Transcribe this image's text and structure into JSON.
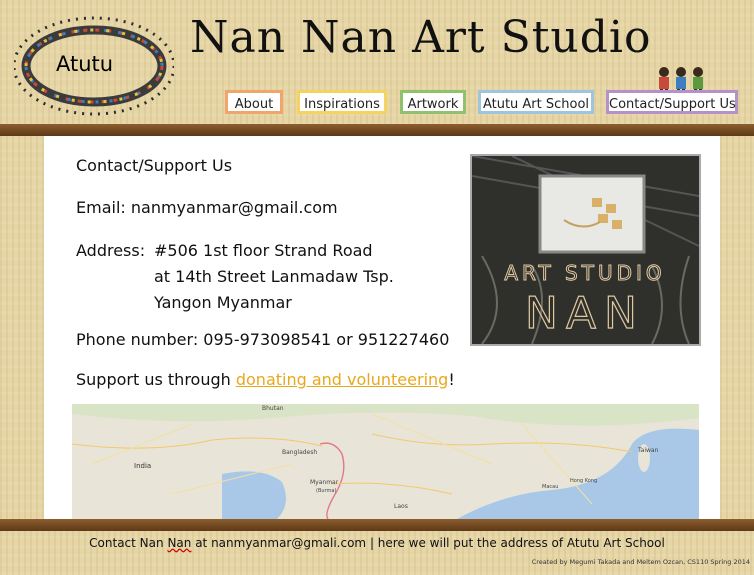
{
  "header": {
    "logo_label": "Atutu",
    "title": "Nan Nan Art Studio"
  },
  "nav": [
    {
      "label": "About",
      "color": "#f2a56b"
    },
    {
      "label": "Inspirations",
      "color": "#f4d35e"
    },
    {
      "label": "Artwork",
      "color": "#8fc26a"
    },
    {
      "label": "Atutu Art School",
      "color": "#9ec4de"
    },
    {
      "label": "Contact/Support Us",
      "color": "#b690c8"
    }
  ],
  "contact": {
    "heading": "Contact/Support Us",
    "email": "Email: nanmyanmar@gmail.com",
    "address_label": "Address:",
    "address_lines": [
      "#506 1st floor Strand Road",
      "at 14th Street Lanmadaw Tsp.",
      "Yangon Myanmar"
    ],
    "phone": "Phone number: 095-973098541 or 951227460",
    "support_prefix": "Support us through ",
    "support_link": "donating and volunteering",
    "support_suffix": "!"
  },
  "photo": {
    "sign_text_top": "ART STUDIO",
    "sign_text_bottom": "NAN"
  },
  "map": {
    "labels": {
      "bhutan": "Bhutan",
      "bangladesh": "Bangladesh",
      "india": "India",
      "myanmar": "Myanmar",
      "burma": "(Burma)",
      "laos": "Laos",
      "taiwan": "Taiwan",
      "hongkong": "Hong Kong",
      "macau": "Macau"
    }
  },
  "footer": {
    "prefix": "Contact Nan ",
    "nan": "Nan",
    "suffix": " at nanmyanmar@gmali.com | here we will put the address of Atutu Art School",
    "credit": "Created by Megumi Takada and Meltem Ozcan, CS110 Spring 2014"
  },
  "colors": {
    "link": "#e8a81e",
    "band": "#6b4220"
  }
}
